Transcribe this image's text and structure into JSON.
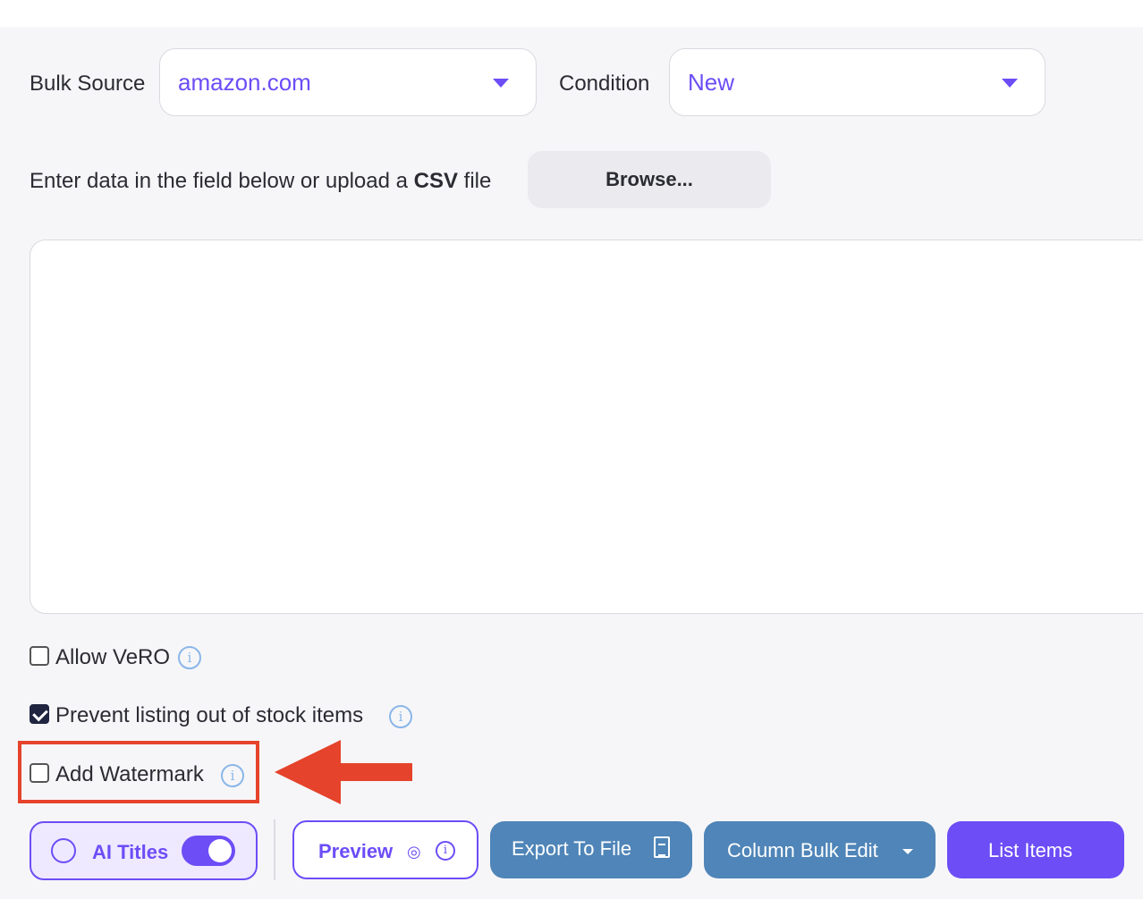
{
  "form": {
    "bulk_source_label": "Bulk Source",
    "bulk_source_value": "amazon.com",
    "condition_label": "Condition",
    "condition_value": "New",
    "upload_prefix": "Enter data in the field below or upload a ",
    "upload_csv": "CSV",
    "upload_suffix": " file",
    "browse_label": "Browse...",
    "textarea_value": ""
  },
  "options": {
    "allow_vero": {
      "label": "Allow VeRO",
      "checked": false
    },
    "prevent_oos": {
      "label": "Prevent listing out of stock items",
      "checked": true
    },
    "add_watermark": {
      "label": "Add Watermark",
      "checked": false
    }
  },
  "toolbar": {
    "ai_titles_label": "AI Titles",
    "ai_titles_enabled": true,
    "preview_label": "Preview",
    "export_label": "Export To File",
    "column_bulk_label": "Column Bulk Edit",
    "list_items_label": "List Items"
  },
  "colors": {
    "accent": "#6c4df6",
    "secondary": "#4f85b8",
    "highlight": "#e5432b"
  }
}
